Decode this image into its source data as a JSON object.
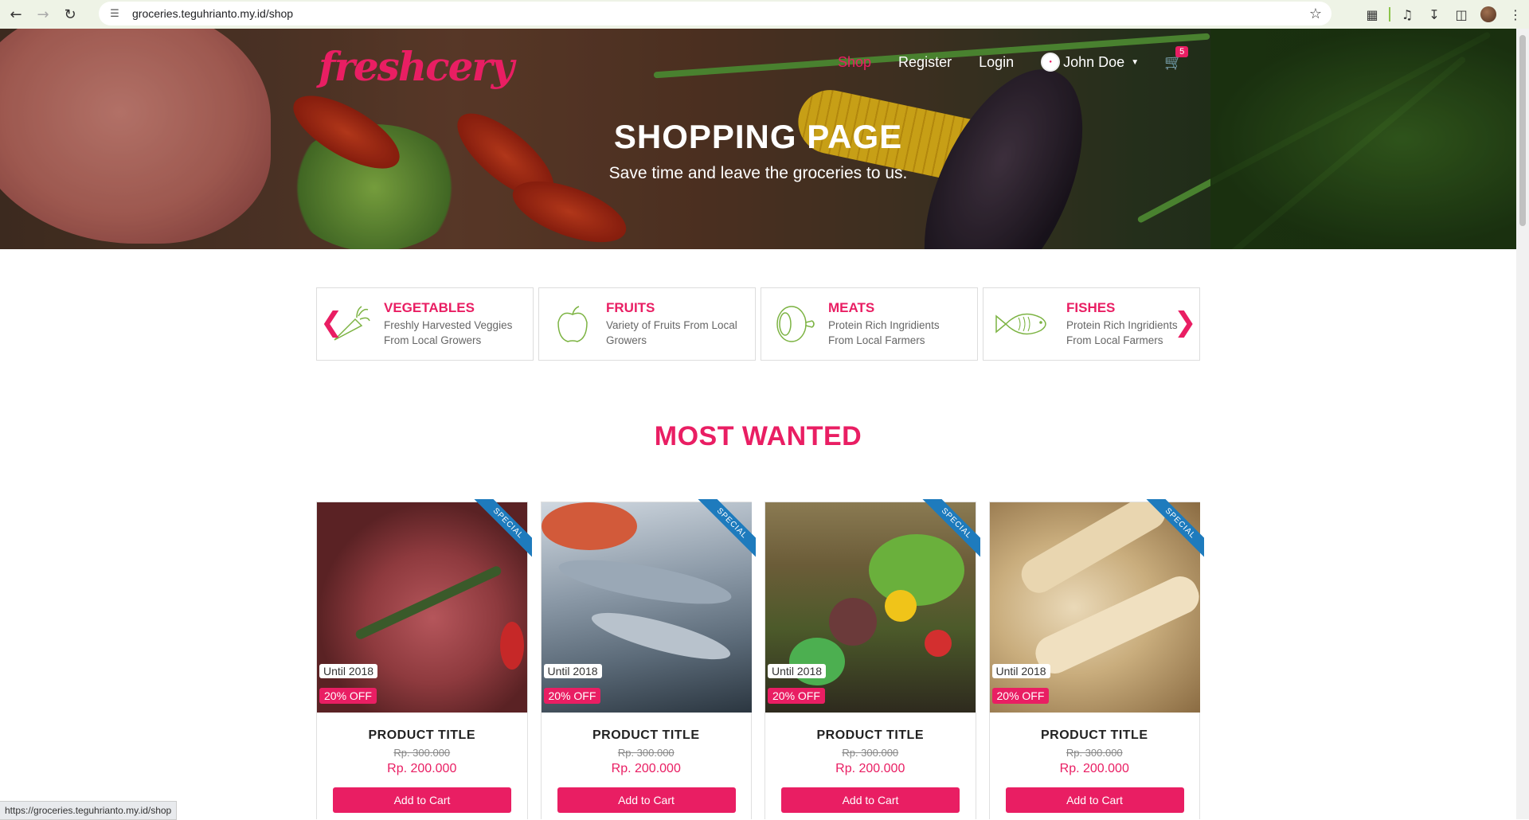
{
  "browser": {
    "url": "groceries.teguhrianto.my.id/shop",
    "status_url": "https://groceries.teguhrianto.my.id/shop"
  },
  "header": {
    "logo": "freshcery",
    "nav": {
      "shop": "Shop",
      "register": "Register",
      "login": "Login",
      "user": "John Doe",
      "cart_count": "5"
    },
    "title": "SHOPPING PAGE",
    "subtitle": "Save time and leave the groceries to us."
  },
  "categories": [
    {
      "title": "VEGETABLES",
      "desc1": "Freshly Harvested Veggies",
      "desc2": "From Local Growers",
      "icon": "carrot-icon"
    },
    {
      "title": "FRUITS",
      "desc1": "Variety of Fruits From Local",
      "desc2": "Growers",
      "icon": "apple-icon"
    },
    {
      "title": "MEATS",
      "desc1": "Protein Rich Ingridients",
      "desc2": "From Local Farmers",
      "icon": "ham-icon"
    },
    {
      "title": "FISHES",
      "desc1": "Protein Rich Ingridients",
      "desc2": "From Local Farmers",
      "icon": "fish-icon"
    }
  ],
  "section_title": "MOST WANTED",
  "products": [
    {
      "ribbon": "SPECIAL",
      "until": "Until 2018",
      "discount": "20% OFF",
      "title": "PRODUCT TITLE",
      "old_price": "Rp. 300.000",
      "price": "Rp. 200.000",
      "button": "Add to Cart"
    },
    {
      "ribbon": "SPECIAL",
      "until": "Until 2018",
      "discount": "20% OFF",
      "title": "PRODUCT TITLE",
      "old_price": "Rp. 300.000",
      "price": "Rp. 200.000",
      "button": "Add to Cart"
    },
    {
      "ribbon": "SPECIAL",
      "until": "Until 2018",
      "discount": "20% OFF",
      "title": "PRODUCT TITLE",
      "old_price": "Rp. 300.000",
      "price": "Rp. 200.000",
      "button": "Add to Cart"
    },
    {
      "ribbon": "SPECIAL",
      "until": "Until 2018",
      "discount": "20% OFF",
      "title": "PRODUCT TITLE",
      "old_price": "Rp. 300.000",
      "price": "Rp. 200.000",
      "button": "Add to Cart"
    }
  ],
  "colors": {
    "accent": "#e91e63",
    "ribbon": "#1e7bbd"
  }
}
